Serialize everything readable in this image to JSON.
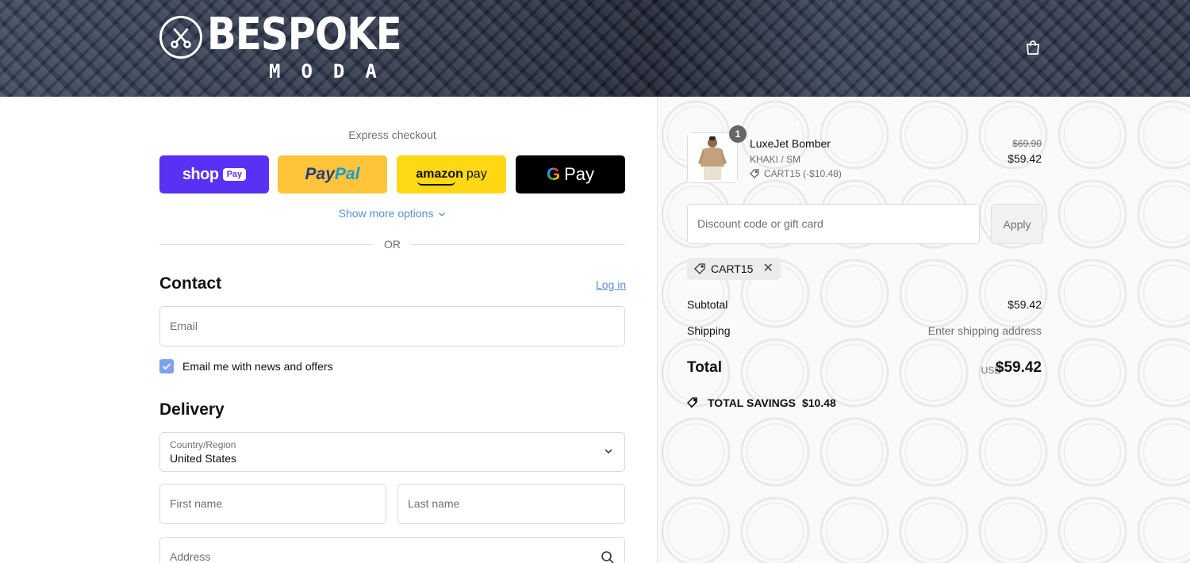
{
  "header": {
    "brand": "BESPOKE",
    "brand_sub": "MODA",
    "bag_icon": "shopping-bag-icon"
  },
  "express": {
    "title": "Express checkout",
    "shop_pay": {
      "word": "shop",
      "badge": "Pay"
    },
    "paypal": {
      "part1": "Pay",
      "part2": "Pal"
    },
    "amazon_pay": {
      "word": "amazon",
      "pay": "pay"
    },
    "google_pay": {
      "g": "G",
      "word": "Pay"
    },
    "show_more": "Show more options",
    "or": "OR"
  },
  "contact": {
    "title": "Contact",
    "login": "Log in",
    "email_placeholder": "Email",
    "news_checkbox": {
      "label": "Email me with news and offers",
      "checked": true
    }
  },
  "delivery": {
    "title": "Delivery",
    "country_label": "Country/Region",
    "country_value": "United States",
    "first_name_placeholder": "First name",
    "last_name_placeholder": "Last name",
    "address_placeholder": "Address"
  },
  "summary": {
    "product": {
      "quantity": "1",
      "name": "LuxeJet Bomber",
      "variant": "KHAKI / SM",
      "discount": "CART15 (-$10.48)",
      "original_price": "$69.90",
      "price": "$59.42"
    },
    "discount_placeholder": "Discount code or gift card",
    "apply": "Apply",
    "applied_code": "CART15",
    "subtotal_label": "Subtotal",
    "subtotal_value": "$59.42",
    "shipping_label": "Shipping",
    "shipping_value": "Enter shipping address",
    "total_label": "Total",
    "currency": "USD",
    "total_value": "$59.42",
    "savings_label": "TOTAL SAVINGS",
    "savings_value": "$10.48"
  },
  "colors": {
    "shop_pay": "#5a31f4",
    "paypal": "#ffc439",
    "amazon_pay": "#ffd814",
    "google_pay": "#000000",
    "link": "#5b8fd8",
    "checkbox": "#7ba2ee"
  }
}
